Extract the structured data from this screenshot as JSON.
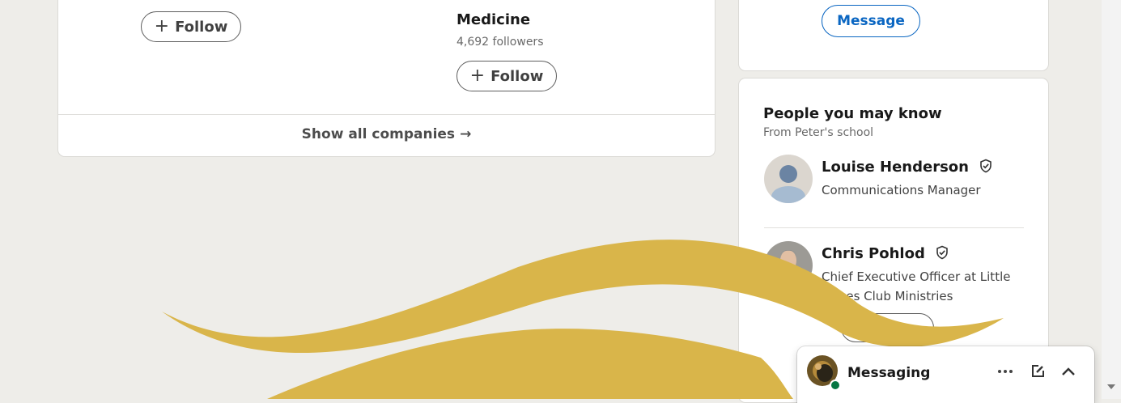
{
  "companies": {
    "items": [
      {
        "name": "",
        "followers": "",
        "follow_label": "Follow"
      },
      {
        "name": "Medicine",
        "followers": "4,692 followers",
        "follow_label": "Follow"
      }
    ],
    "show_all_label": "Show all companies",
    "show_all_arrow": "→"
  },
  "profile_card": {
    "message_label": "Message"
  },
  "people_you_may_know": {
    "title": "People you may know",
    "subtitle": "From Peter's school",
    "people": [
      {
        "name": "Louise Henderson",
        "title": "Communications Manager",
        "verified": true,
        "avatar": "default-avatar"
      },
      {
        "name": "Chris Pohlod",
        "title": "Chief Executive Officer at Little Pieces Club Ministries",
        "verified": true,
        "avatar": "photo"
      }
    ]
  },
  "messaging": {
    "label": "Messaging",
    "status": "online"
  },
  "colors": {
    "accent_blue": "#0a66c2",
    "swoosh_gold": "#d9b54a",
    "online_green": "#057642",
    "page_bg": "#eeede9"
  }
}
